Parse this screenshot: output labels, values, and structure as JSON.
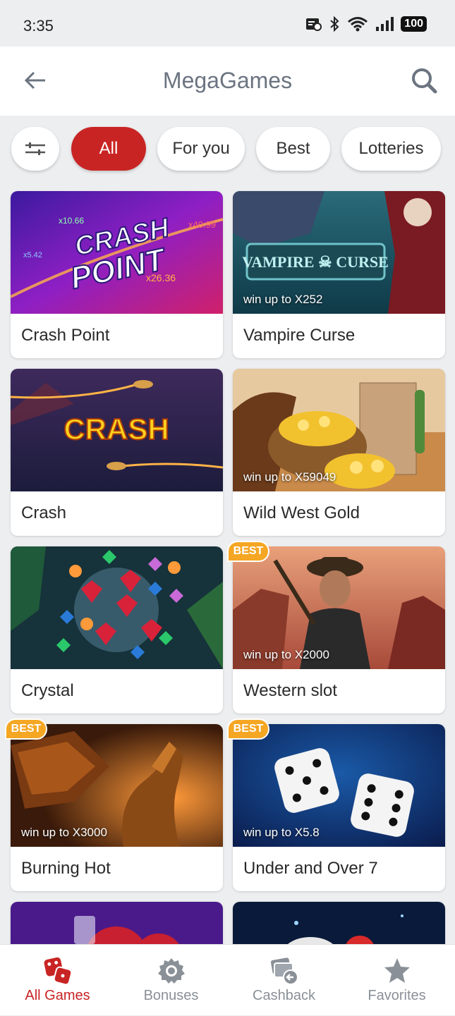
{
  "status": {
    "time": "3:35",
    "battery": "100"
  },
  "header": {
    "title": "MegaGames"
  },
  "filters": [
    {
      "label": "All",
      "active": true
    },
    {
      "label": "For you"
    },
    {
      "label": "Best"
    },
    {
      "label": "Lotteries"
    }
  ],
  "games": [
    {
      "name": "Crash Point",
      "art_text_1": "CRASH",
      "art_text_2": "POINT",
      "mult_1": "x10.66",
      "mult_2": "x40.99",
      "mult_3": "x5.42",
      "mult_4": "x26.36"
    },
    {
      "name": "Vampire Curse",
      "art_text": "VAMPIRE ☠ CURSE",
      "win": "win up to X252"
    },
    {
      "name": "Crash",
      "art_text": "CRASH"
    },
    {
      "name": "Wild West Gold",
      "win": "win up to X59049"
    },
    {
      "name": "Crystal"
    },
    {
      "name": "Western slot",
      "badge": "BEST",
      "win": "win up to X2000"
    },
    {
      "name": "Burning Hot",
      "badge": "BEST",
      "win": "win up to X3000"
    },
    {
      "name": "Under and Over 7",
      "badge": "BEST",
      "win": "win up to X5.8"
    }
  ],
  "nav": [
    {
      "label": "All Games",
      "icon": "dice-icon",
      "active": true
    },
    {
      "label": "Bonuses",
      "icon": "gear-icon"
    },
    {
      "label": "Cashback",
      "icon": "cashback-icon"
    },
    {
      "label": "Favorites",
      "icon": "star-icon"
    }
  ],
  "colors": {
    "accent": "#c92424",
    "badge": "#f5a623",
    "background": "#eceef0"
  }
}
